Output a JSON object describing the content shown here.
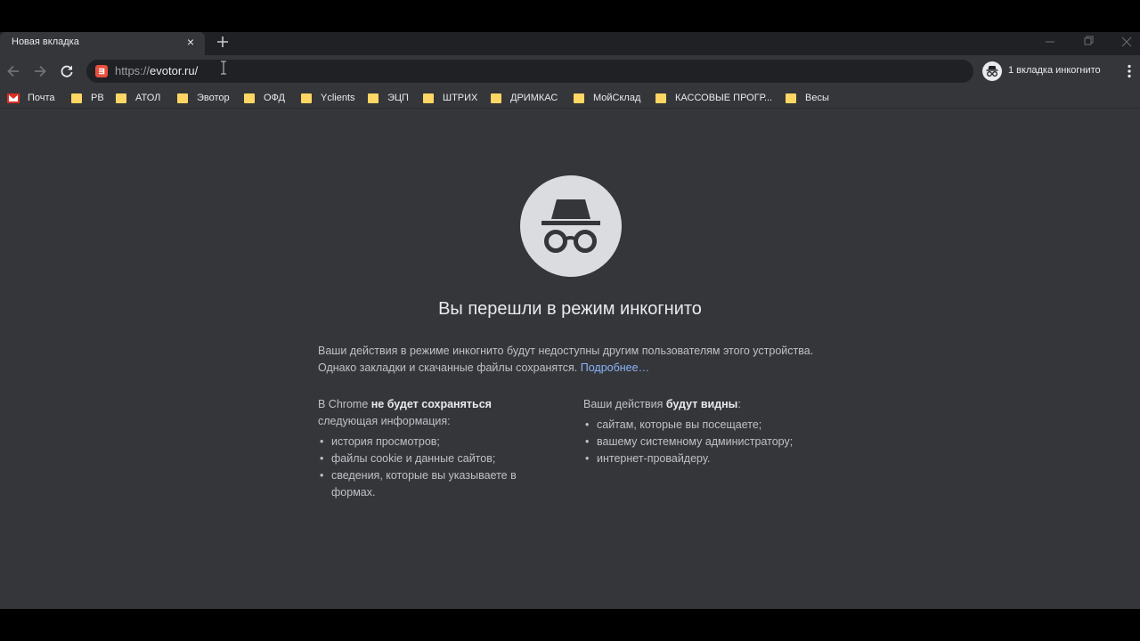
{
  "tab": {
    "title": "Новая вкладка",
    "close_glyph": "×"
  },
  "omnibox": {
    "url_scheme": "https://",
    "url_host": "evotor.ru/"
  },
  "incognito_chip": {
    "label": "1 вкладка инкогнито"
  },
  "bookmarks": [
    {
      "label": "Почта",
      "icon": "gmail-icon"
    },
    {
      "label": "РВ",
      "icon": "folder-icon"
    },
    {
      "label": "АТОЛ",
      "icon": "folder-icon"
    },
    {
      "label": "Эвотор",
      "icon": "folder-icon"
    },
    {
      "label": "ОФД",
      "icon": "folder-icon"
    },
    {
      "label": "Yclients",
      "icon": "folder-icon"
    },
    {
      "label": "ЭЦП",
      "icon": "folder-icon"
    },
    {
      "label": "ШТРИХ",
      "icon": "folder-icon"
    },
    {
      "label": "ДРИМКАС",
      "icon": "folder-icon"
    },
    {
      "label": "МойСклад",
      "icon": "folder-icon"
    },
    {
      "label": "КАССОВЫЕ ПРОГР...",
      "icon": "folder-icon"
    },
    {
      "label": "Весы",
      "icon": "folder-icon"
    }
  ],
  "page": {
    "title": "Вы перешли в режим инкогнито",
    "intro_text": "Ваши действия в режиме инкогнито будут недоступны другим пользователям этого устройства. Однако закладки и скачанные файлы сохранятся.",
    "learn_more": "Подробнее…",
    "left": {
      "heading_pre": "В Chrome ",
      "heading_strong": "не будет сохраняться",
      "heading_post": "следующая информация:",
      "items": [
        "история просмотров;",
        "файлы cookie и данные сайтов;",
        "сведения, которые вы указываете в формах."
      ]
    },
    "right": {
      "heading_pre": "Ваши действия ",
      "heading_strong": "будут видны",
      "heading_post": ":",
      "items": [
        "сайтам, которые вы посещаете;",
        "вашему системному администратору;",
        "интернет-провайдеру."
      ]
    }
  },
  "colors": {
    "frame": "#202124",
    "toolbar": "#35363a",
    "text": "#e8eaed",
    "link": "#8ab4f8"
  }
}
